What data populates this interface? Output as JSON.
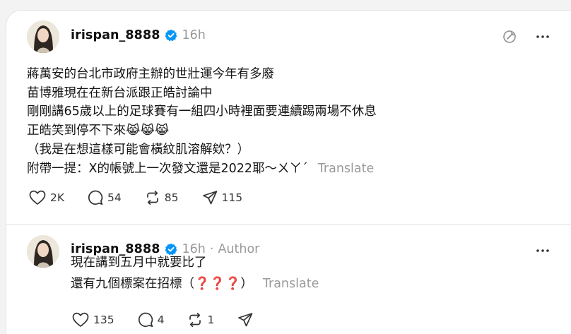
{
  "posts": [
    {
      "username": "irispan_8888",
      "time": "16h",
      "lines": [
        "蔣萬安的台北市政府主辦的世壯運今年有多廢",
        "苗博雅現在在新台派跟正皓討論中",
        "剛剛講65歲以上的足球賽有一組四小時裡面要連續踢兩場不休息",
        "正皓笑到停不下來😹😹😹",
        "（我是在想這樣可能會橫紋肌溶解欸？）",
        "附帶一提：X的帳號上一次發文還是2022耶～ㄨㄚˊ"
      ],
      "translate": "Translate",
      "likes": "2K",
      "replies": "54",
      "reposts": "85",
      "shares": "115"
    },
    {
      "username": "irispan_8888",
      "time": "16h",
      "dot": "·",
      "author": "Author",
      "lines": [
        "現在講到五月中就要比了",
        "還有九個標案在招標（❓❓❓）"
      ],
      "translate": "Translate",
      "likes": "135",
      "replies": "4",
      "reposts": "1",
      "shares": ""
    }
  ],
  "icons": {
    "verified": "verified-badge-icon",
    "edit": "edit-off-icon",
    "more": "more-options-icon",
    "like": "heart-icon",
    "reply": "reply-bubble-icon",
    "repost": "repost-icon",
    "share": "send-icon"
  },
  "colors": {
    "verified": "#0095f6",
    "muted": "#9a9a9a"
  }
}
